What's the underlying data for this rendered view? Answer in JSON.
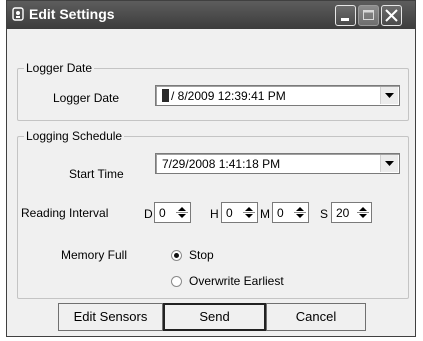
{
  "window": {
    "title": "Edit Settings",
    "icons": {
      "app": "app-window-icon",
      "minimize": "minimize-icon",
      "maximize": "maximize-icon",
      "close": "close-icon"
    }
  },
  "logger_date_group": {
    "legend": "Logger Date",
    "field_label": "Logger Date",
    "value_rest": "/ 8/2009 12:39:41 PM"
  },
  "schedule_group": {
    "legend": "Logging Schedule",
    "start_time_label": "Start Time",
    "start_time_value": "7/29/2008  1:41:18 PM",
    "interval_label": "Reading Interval",
    "interval": [
      {
        "unit": "D",
        "value": "0"
      },
      {
        "unit": "H",
        "value": "0"
      },
      {
        "unit": "M",
        "value": "0"
      },
      {
        "unit": "S",
        "value": "20"
      }
    ],
    "memory_full_label": "Memory Full",
    "memory_options": [
      {
        "label": "Stop",
        "selected": true
      },
      {
        "label": "Overwrite Earliest",
        "selected": false
      }
    ]
  },
  "buttons": {
    "edit_sensors": "Edit Sensors",
    "send": "Send",
    "cancel": "Cancel"
  }
}
